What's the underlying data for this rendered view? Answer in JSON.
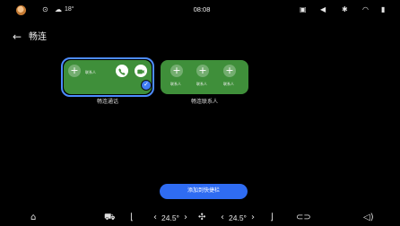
{
  "status_bar": {
    "temperature": "18°",
    "time": "08:08"
  },
  "header": {
    "back_icon": "back-arrow-icon",
    "title": "畅连"
  },
  "cards": [
    {
      "caption": "畅连通话",
      "contact_label": "联系人",
      "selected": true,
      "accent": "#3f8f3a"
    },
    {
      "caption": "畅连联系人",
      "contact_labels": [
        "联系人",
        "联系人",
        "联系人"
      ],
      "selected": false,
      "accent": "#3f8f3a"
    }
  ],
  "add_button": {
    "label": "添加到快捷栏",
    "color": "#2f6cf2"
  },
  "dock": {
    "left_temp": "24.5°",
    "right_temp": "24.5°"
  },
  "colors": {
    "selection": "#4d8cff",
    "card": "#3f8f3a",
    "background": "#000000"
  }
}
